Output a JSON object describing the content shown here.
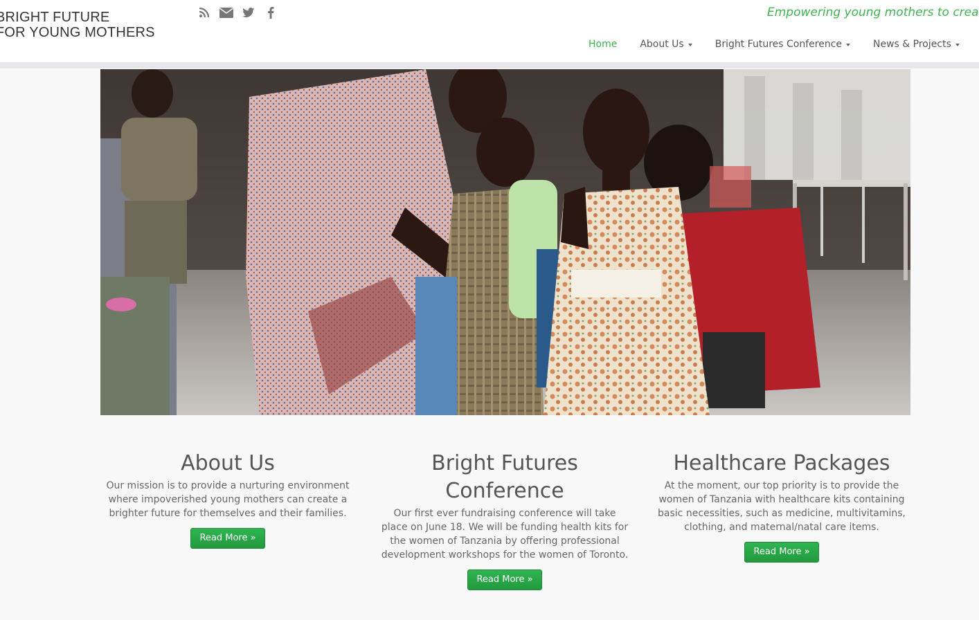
{
  "header": {
    "logo_line1": "BRIGHT FUTURE",
    "logo_line2": "FOR YOUNG MOTHERS",
    "tagline": "Empowering young mothers to creat",
    "social_icons": [
      "rss-icon",
      "envelope-icon",
      "twitter-icon",
      "facebook-icon"
    ]
  },
  "nav": {
    "home": "Home",
    "about": "About Us",
    "conference": "Bright Futures Conference",
    "news": "News & Projects"
  },
  "colors": {
    "accent": "#3eb34f",
    "button": "#2aa846",
    "text": "#555555"
  },
  "hero": {
    "image_alt": "Woman with young children in a community hall"
  },
  "sections": [
    {
      "title": "About Us",
      "body": "Our mission is to provide a nurturing environment where impoverished young mothers can create a brighter future for themselves and their families.",
      "button": "Read More »"
    },
    {
      "title": "Bright Futures Conference",
      "body": "Our first ever fundraising conference will take place on June 18. We will be funding health kits for the women of Tanzania by offering professional development workshops for the women of Toronto.",
      "button": "Read More »"
    },
    {
      "title": "Healthcare Packages",
      "body": "At the moment, our top priority is to provide the women of Tanzania with healthcare kits containing basic necessities, such as medicine, multivitamins, clothing, and maternal/natal care items.",
      "button": "Read More »"
    }
  ]
}
